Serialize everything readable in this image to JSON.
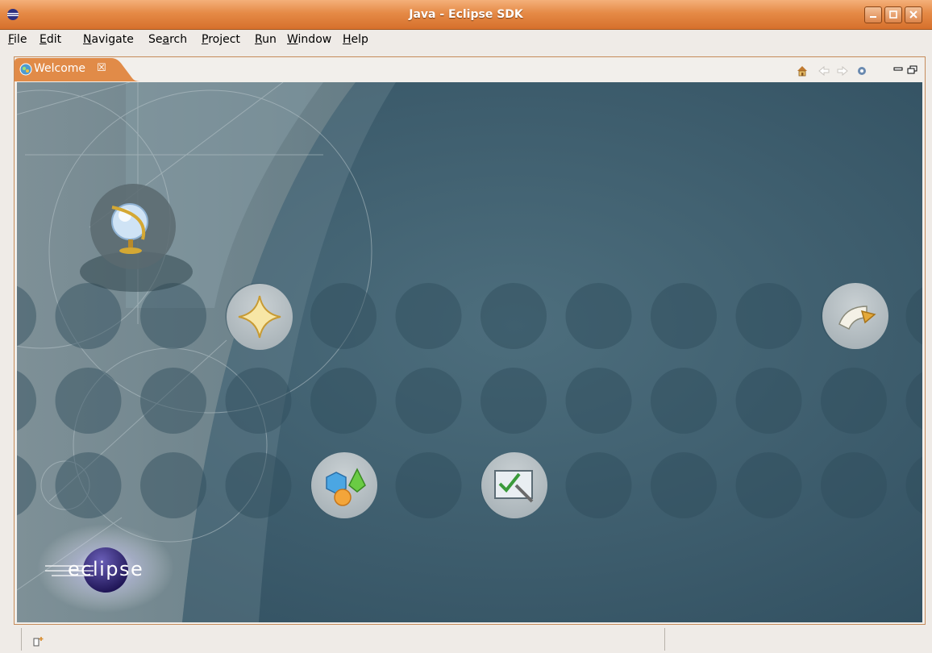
{
  "window": {
    "title": "Java - Eclipse SDK"
  },
  "menu": {
    "items": [
      "File",
      "Edit",
      "Navigate",
      "Search",
      "Project",
      "Run",
      "Window",
      "Help"
    ]
  },
  "tab": {
    "label": "Welcome",
    "close": "☒"
  },
  "toolbar": {
    "icons": [
      "home-icon",
      "back-icon",
      "forward-icon",
      "workbench-icon",
      "minimize-view-icon",
      "maximize-view-icon"
    ]
  },
  "welcome": {
    "logo_text": "eclipse",
    "icons": [
      "overview-icon",
      "whats-new-icon",
      "samples-icon",
      "tutorials-icon",
      "workbench-icon"
    ]
  },
  "colors": {
    "title_bar": "#e58a46",
    "tab_accent": "#e18b48",
    "content_bg": "#3d5c6c"
  }
}
